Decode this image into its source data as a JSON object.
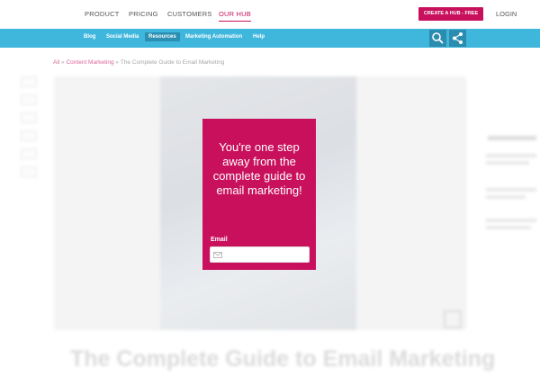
{
  "topnav": {
    "items": [
      "PRODUCT",
      "PRICING",
      "CUSTOMERS",
      "OUR HUB"
    ],
    "active_item": "OUR HUB",
    "cta_label": "CREATE A HUB - FREE",
    "login_label": "LOGIN"
  },
  "subnav": {
    "items": [
      "Blog",
      "Social Media",
      "Resources",
      "Marketing Automation",
      "Help"
    ],
    "active_item": "Resources",
    "icons": [
      "search-icon",
      "share-icon"
    ]
  },
  "breadcrumb": {
    "root": "All",
    "separator": "»",
    "category": "Content Marketing",
    "current": "The Complete Guide to Email Marketing"
  },
  "article": {
    "title": "The Complete Guide to Email Marketing"
  },
  "popup": {
    "heading": "You're one step away from the complete guide to email marketing!",
    "email_label": "Email",
    "email_value": "",
    "email_placeholder": ""
  },
  "colors": {
    "brand": "#c8105c",
    "subnav": "#3fb6dc",
    "subnav_active": "#2b8fb2"
  }
}
